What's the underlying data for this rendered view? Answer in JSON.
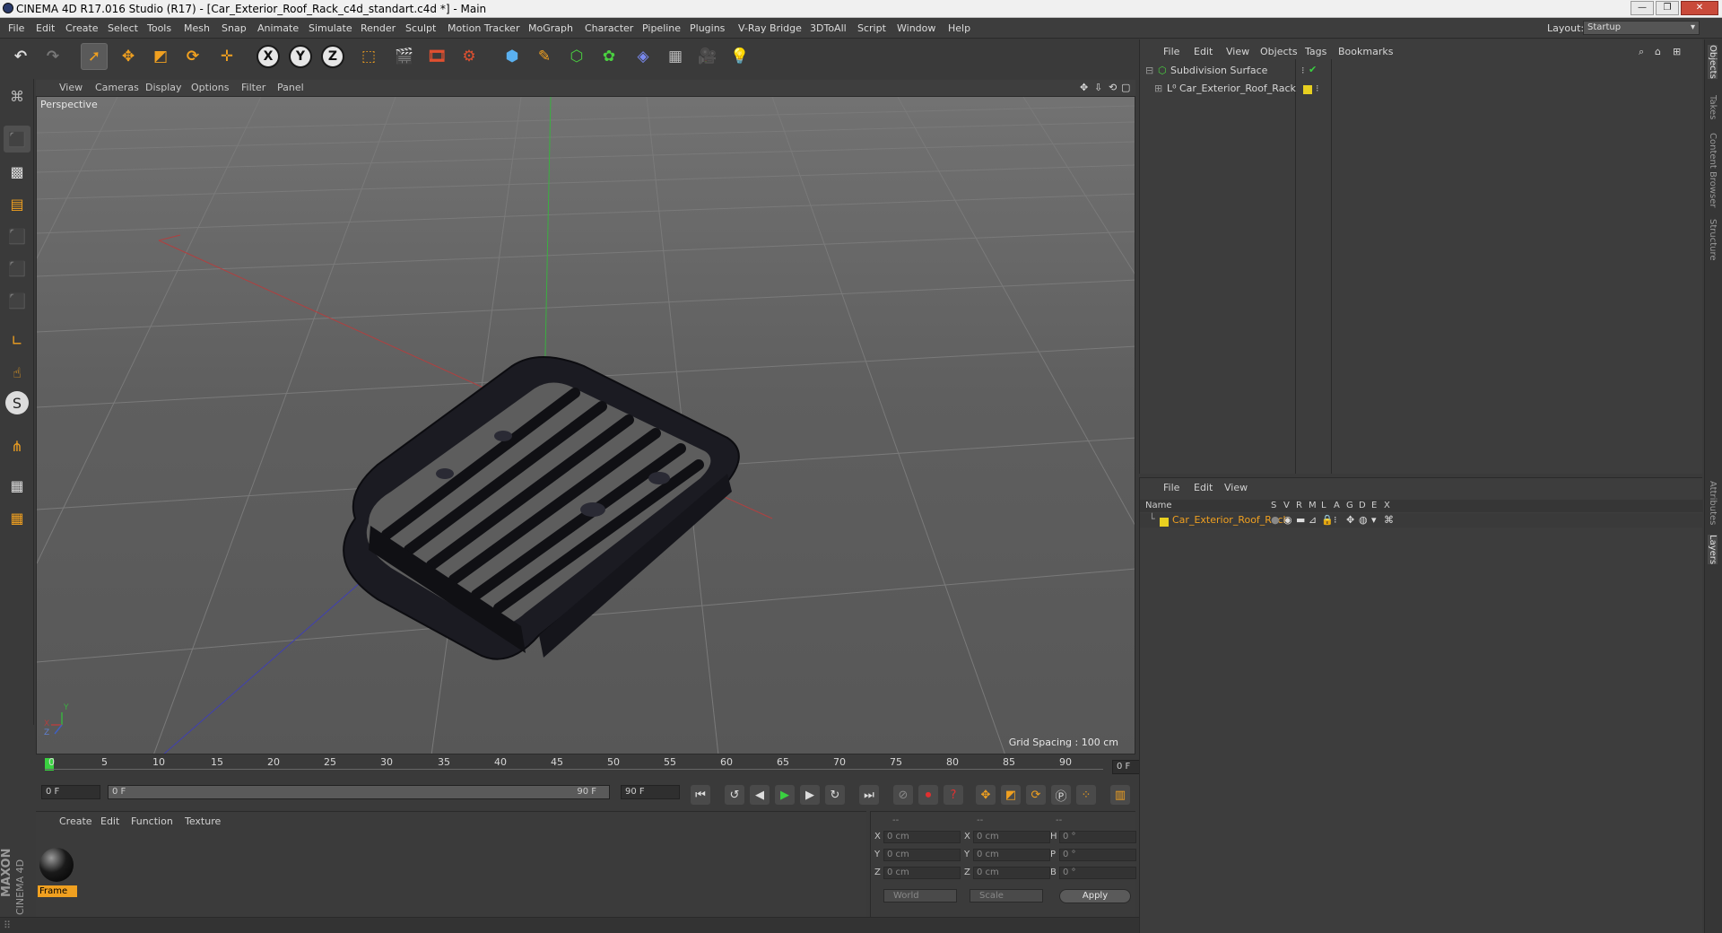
{
  "window": {
    "title": "CINEMA 4D R17.016 Studio (R17) - [Car_Exterior_Roof_Rack_c4d_standart.c4d *] - Main",
    "minimize": "—",
    "maximize": "❐",
    "close": "✕"
  },
  "menu": [
    "File",
    "Edit",
    "Create",
    "Select",
    "Tools",
    "Mesh",
    "Snap",
    "Animate",
    "Simulate",
    "Render",
    "Sculpt",
    "Motion Tracker",
    "MoGraph",
    "Character",
    "Pipeline",
    "Plugins",
    "V-Ray Bridge",
    "3DToAll",
    "Script",
    "Window",
    "Help"
  ],
  "layout": {
    "label": "Layout:",
    "value": "Startup"
  },
  "viewport": {
    "menu": [
      "View",
      "Cameras",
      "Display",
      "Options",
      "Filter",
      "Panel"
    ],
    "label": "Perspective",
    "grid_spacing": "Grid Spacing : 100 cm",
    "axis_labels": {
      "x": "X",
      "y": "Y",
      "z": "Z"
    }
  },
  "timeline": {
    "ticks": [
      "0",
      "5",
      "10",
      "15",
      "20",
      "25",
      "30",
      "35",
      "40",
      "45",
      "50",
      "55",
      "60",
      "65",
      "70",
      "75",
      "80",
      "85",
      "90"
    ],
    "current_frame": "0 F",
    "start": "0 F",
    "range_start": "0 F",
    "range_end": "90 F",
    "end": "90 F"
  },
  "materials": {
    "menu": [
      "Create",
      "Edit",
      "Function",
      "Texture"
    ],
    "items": [
      {
        "name": "Frame"
      }
    ]
  },
  "coordinates": {
    "headers": [
      "--",
      "--",
      "--"
    ],
    "rows": [
      {
        "a": "X",
        "av": "0 cm",
        "b": "X",
        "bv": "0 cm",
        "c": "H",
        "cv": "0 °"
      },
      {
        "a": "Y",
        "av": "0 cm",
        "b": "Y",
        "bv": "0 cm",
        "c": "P",
        "cv": "0 °"
      },
      {
        "a": "Z",
        "av": "0 cm",
        "b": "Z",
        "bv": "0 cm",
        "c": "B",
        "cv": "0 °"
      }
    ],
    "mode1": "World",
    "mode2": "Scale",
    "apply": "Apply"
  },
  "objects": {
    "menu": [
      "File",
      "Edit",
      "View",
      "Objects",
      "Tags",
      "Bookmarks"
    ],
    "items": [
      {
        "name": "Subdivision Surface"
      },
      {
        "name": "Car_Exterior_Roof_Rack"
      }
    ]
  },
  "layers": {
    "menu": [
      "File",
      "Edit",
      "View"
    ],
    "columns": [
      "Name",
      "S",
      "V",
      "R",
      "M",
      "L",
      "A",
      "G",
      "D",
      "E",
      "X"
    ],
    "items": [
      {
        "name": "Car_Exterior_Roof_Rack"
      }
    ]
  },
  "side_tabs": [
    "Objects",
    "Takes",
    "Content Browser",
    "Structure",
    "Attributes",
    "Layers"
  ],
  "brand": {
    "line1": "MAXON",
    "line2": "CINEMA 4D"
  },
  "colors": {
    "accent": "#f0a020",
    "layer_color": "#e8d020",
    "viewport_bg": "#5d5d5d"
  }
}
